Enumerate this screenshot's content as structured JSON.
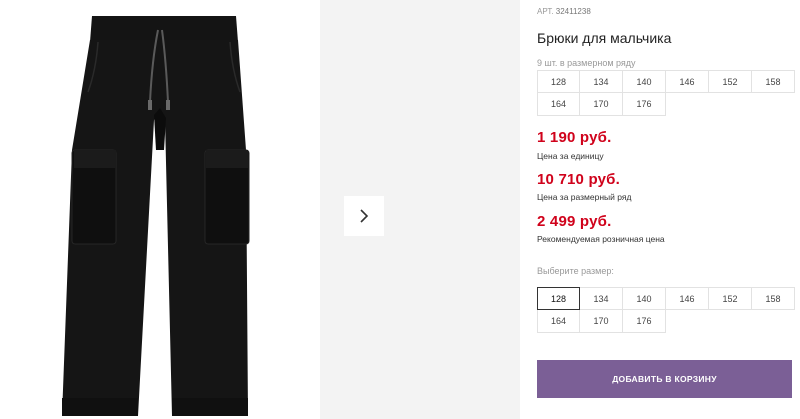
{
  "gallery": {
    "main_image": "black-cargo-trousers-photo",
    "next_icon": "chevron-right-icon"
  },
  "product": {
    "article_prefix": "АРТ.",
    "article_number": "32411238",
    "title": "Брюки для мальчика",
    "series_note": "9 шт. в размерном ряду",
    "series_sizes": [
      "128",
      "134",
      "140",
      "146",
      "152",
      "158",
      "164",
      "170",
      "176"
    ]
  },
  "prices": {
    "unit_price": "1 190 руб.",
    "unit_label": "Цена за единицу",
    "series_price": "10 710 руб.",
    "series_label": "Цена за размерный ряд",
    "retail_price": "2 499 руб.",
    "retail_label": "Рекомендуемая розничная цена"
  },
  "size_picker": {
    "label": "Выберите размер:",
    "sizes": [
      "128",
      "134",
      "140",
      "146",
      "152",
      "158",
      "164",
      "170",
      "176"
    ],
    "selected": "128"
  },
  "cart": {
    "button_label": "ДОБАВИТЬ В КОРЗИНУ"
  },
  "colors": {
    "price": "#d0021b",
    "button": "#7b5f96",
    "thumb_bg": "#f3f3f3"
  }
}
